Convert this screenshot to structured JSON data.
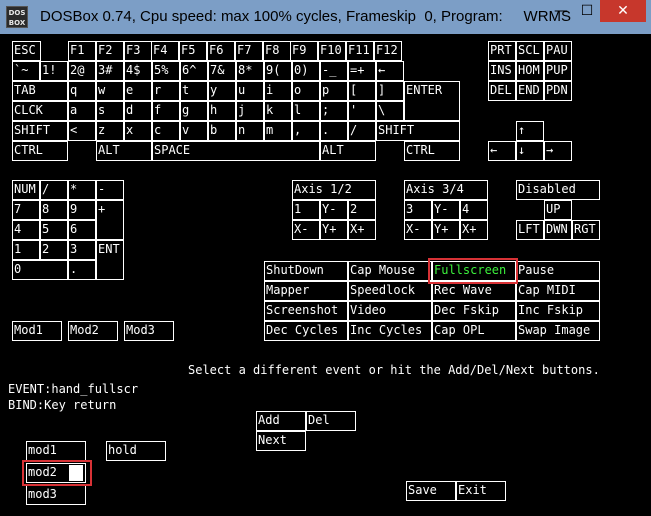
{
  "window": {
    "icon_label": "DOS BOX",
    "title": "DOSBox 0.74, Cpu speed: max 100% cycles, Frameskip  0, Program:     WRMS",
    "minimize": "—",
    "maximize": "☐",
    "close": "✕"
  },
  "keyboard": {
    "row_fn": [
      "ESC",
      "F1",
      "F2",
      "F3",
      "F4",
      "F5",
      "F6",
      "F7",
      "F8",
      "F9",
      "F10",
      "F11",
      "F12"
    ],
    "row_num": [
      "`~",
      "1!",
      "2@",
      "3#",
      "4$",
      "5%",
      "6^",
      "7&",
      "8*",
      "9(",
      "0)",
      "-_",
      "=+",
      "←"
    ],
    "row_q": [
      "TAB",
      "q",
      "w",
      "e",
      "r",
      "t",
      "y",
      "u",
      "i",
      "o",
      "p",
      "[",
      "]",
      "ENTER"
    ],
    "row_a": [
      "CLCK",
      "a",
      "s",
      "d",
      "f",
      "g",
      "h",
      "j",
      "k",
      "l",
      ";",
      "'",
      "\\"
    ],
    "row_z": [
      "SHIFT",
      "<",
      "z",
      "x",
      "c",
      "v",
      "b",
      "n",
      "m",
      ",",
      ".",
      "/",
      "SHIFT"
    ],
    "row_bottom": [
      "CTRL",
      "ALT",
      "SPACE",
      "ALT",
      "CTRL"
    ]
  },
  "nav": {
    "row1": [
      "PRT",
      "SCL",
      "PAU"
    ],
    "row2": [
      "INS",
      "HOM",
      "PUP"
    ],
    "row3": [
      "DEL",
      "END",
      "PDN"
    ],
    "up": "↑",
    "left": "←",
    "down": "↓",
    "right": "→"
  },
  "numpad": {
    "row1": [
      "NUM",
      "/",
      "*",
      "-"
    ],
    "row2": [
      "7",
      "8",
      "9",
      "+"
    ],
    "row3": [
      "4",
      "5",
      "6"
    ],
    "row4": [
      "1",
      "2",
      "3",
      "ENT"
    ],
    "row5": [
      "0",
      "."
    ]
  },
  "joystick": {
    "axis12": "Axis 1/2",
    "axis34": "Axis 3/4",
    "a1": [
      "1",
      "Y-",
      "2"
    ],
    "a2": [
      "X-",
      "Y+",
      "X+"
    ],
    "b1": [
      "3",
      "Y-",
      "4"
    ],
    "b2": [
      "X-",
      "Y+",
      "X+"
    ],
    "disabled": "Disabled",
    "hat_up": "UP",
    "hat_row": [
      "LFT",
      "DWN",
      "RGT"
    ]
  },
  "events": {
    "row1": [
      "ShutDown",
      "Cap Mouse",
      "Fullscreen",
      "Pause"
    ],
    "row2": [
      "Mapper",
      "Speedlock",
      "Rec Wave",
      "Cap MIDI"
    ],
    "row3": [
      "Screenshot",
      "Video",
      "Dec Fskip",
      "Inc Fskip"
    ],
    "row4": [
      "Dec Cycles",
      "Inc Cycles",
      "Cap OPL",
      "Swap Image"
    ]
  },
  "mods": [
    "Mod1",
    "Mod2",
    "Mod3"
  ],
  "status": {
    "message": "Select a different event or hit the Add/Del/Next buttons.",
    "event": "EVENT:hand_fullscr",
    "bind": "BIND:Key return"
  },
  "controls": {
    "add": "Add",
    "del": "Del",
    "next": "Next",
    "mod1": "mod1",
    "hold": "hold",
    "mod2": "mod2",
    "mod3": "mod3",
    "save": "Save",
    "exit": "Exit"
  },
  "colors": {
    "background": "#000000",
    "text": "#ffffff",
    "selected_event": "#3cf03c",
    "highlight_box": "#d83236",
    "titlebar": "#7c9ec6",
    "close_button": "#c7372c"
  }
}
